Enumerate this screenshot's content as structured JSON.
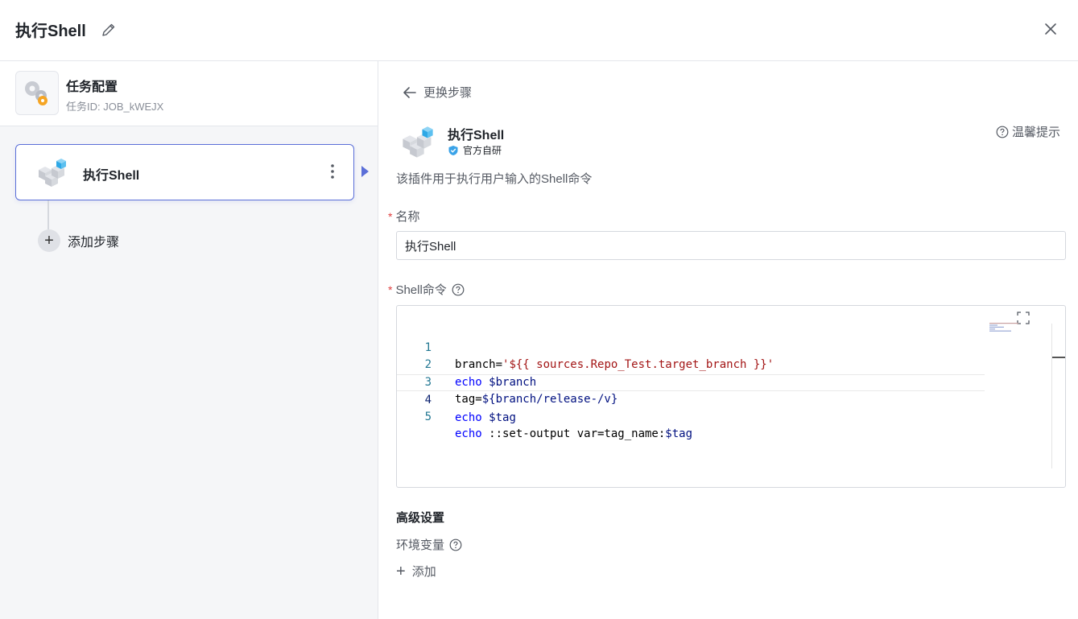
{
  "header": {
    "title": "执行Shell",
    "edit_icon": "pencil-icon",
    "close_icon": "close-icon"
  },
  "job": {
    "name": "任务配置",
    "id_text": "任务ID: JOB_kWEJX",
    "icon": "gears-icon"
  },
  "steps": [
    {
      "label": "执行Shell",
      "icon": "cubes-icon"
    }
  ],
  "add_step_label": "添加步骤",
  "plugin": {
    "back_label": "更换步骤",
    "name": "执行Shell",
    "badge": "官方自研",
    "tip_label": "温馨提示",
    "description": "该插件用于执行用户输入的Shell命令"
  },
  "form": {
    "name_label": "名称",
    "name_value": "执行Shell",
    "shell_label": "Shell命令",
    "code_lines": [
      {
        "num": "1",
        "text": "branch='${{ sources.Repo_Test.target_branch }}'"
      },
      {
        "num": "2",
        "text": "echo $branch"
      },
      {
        "num": "3",
        "text": "tag=${branch/release-/v}"
      },
      {
        "num": "4",
        "text": "echo $tag"
      },
      {
        "num": "5",
        "text": "echo ::set-output var=tag_name:$tag"
      }
    ],
    "advanced_title": "高级设置",
    "env_label": "环境变量",
    "add_label": "添加"
  },
  "colors": {
    "accent": "#5b6fd8",
    "required": "#e03e3e"
  }
}
